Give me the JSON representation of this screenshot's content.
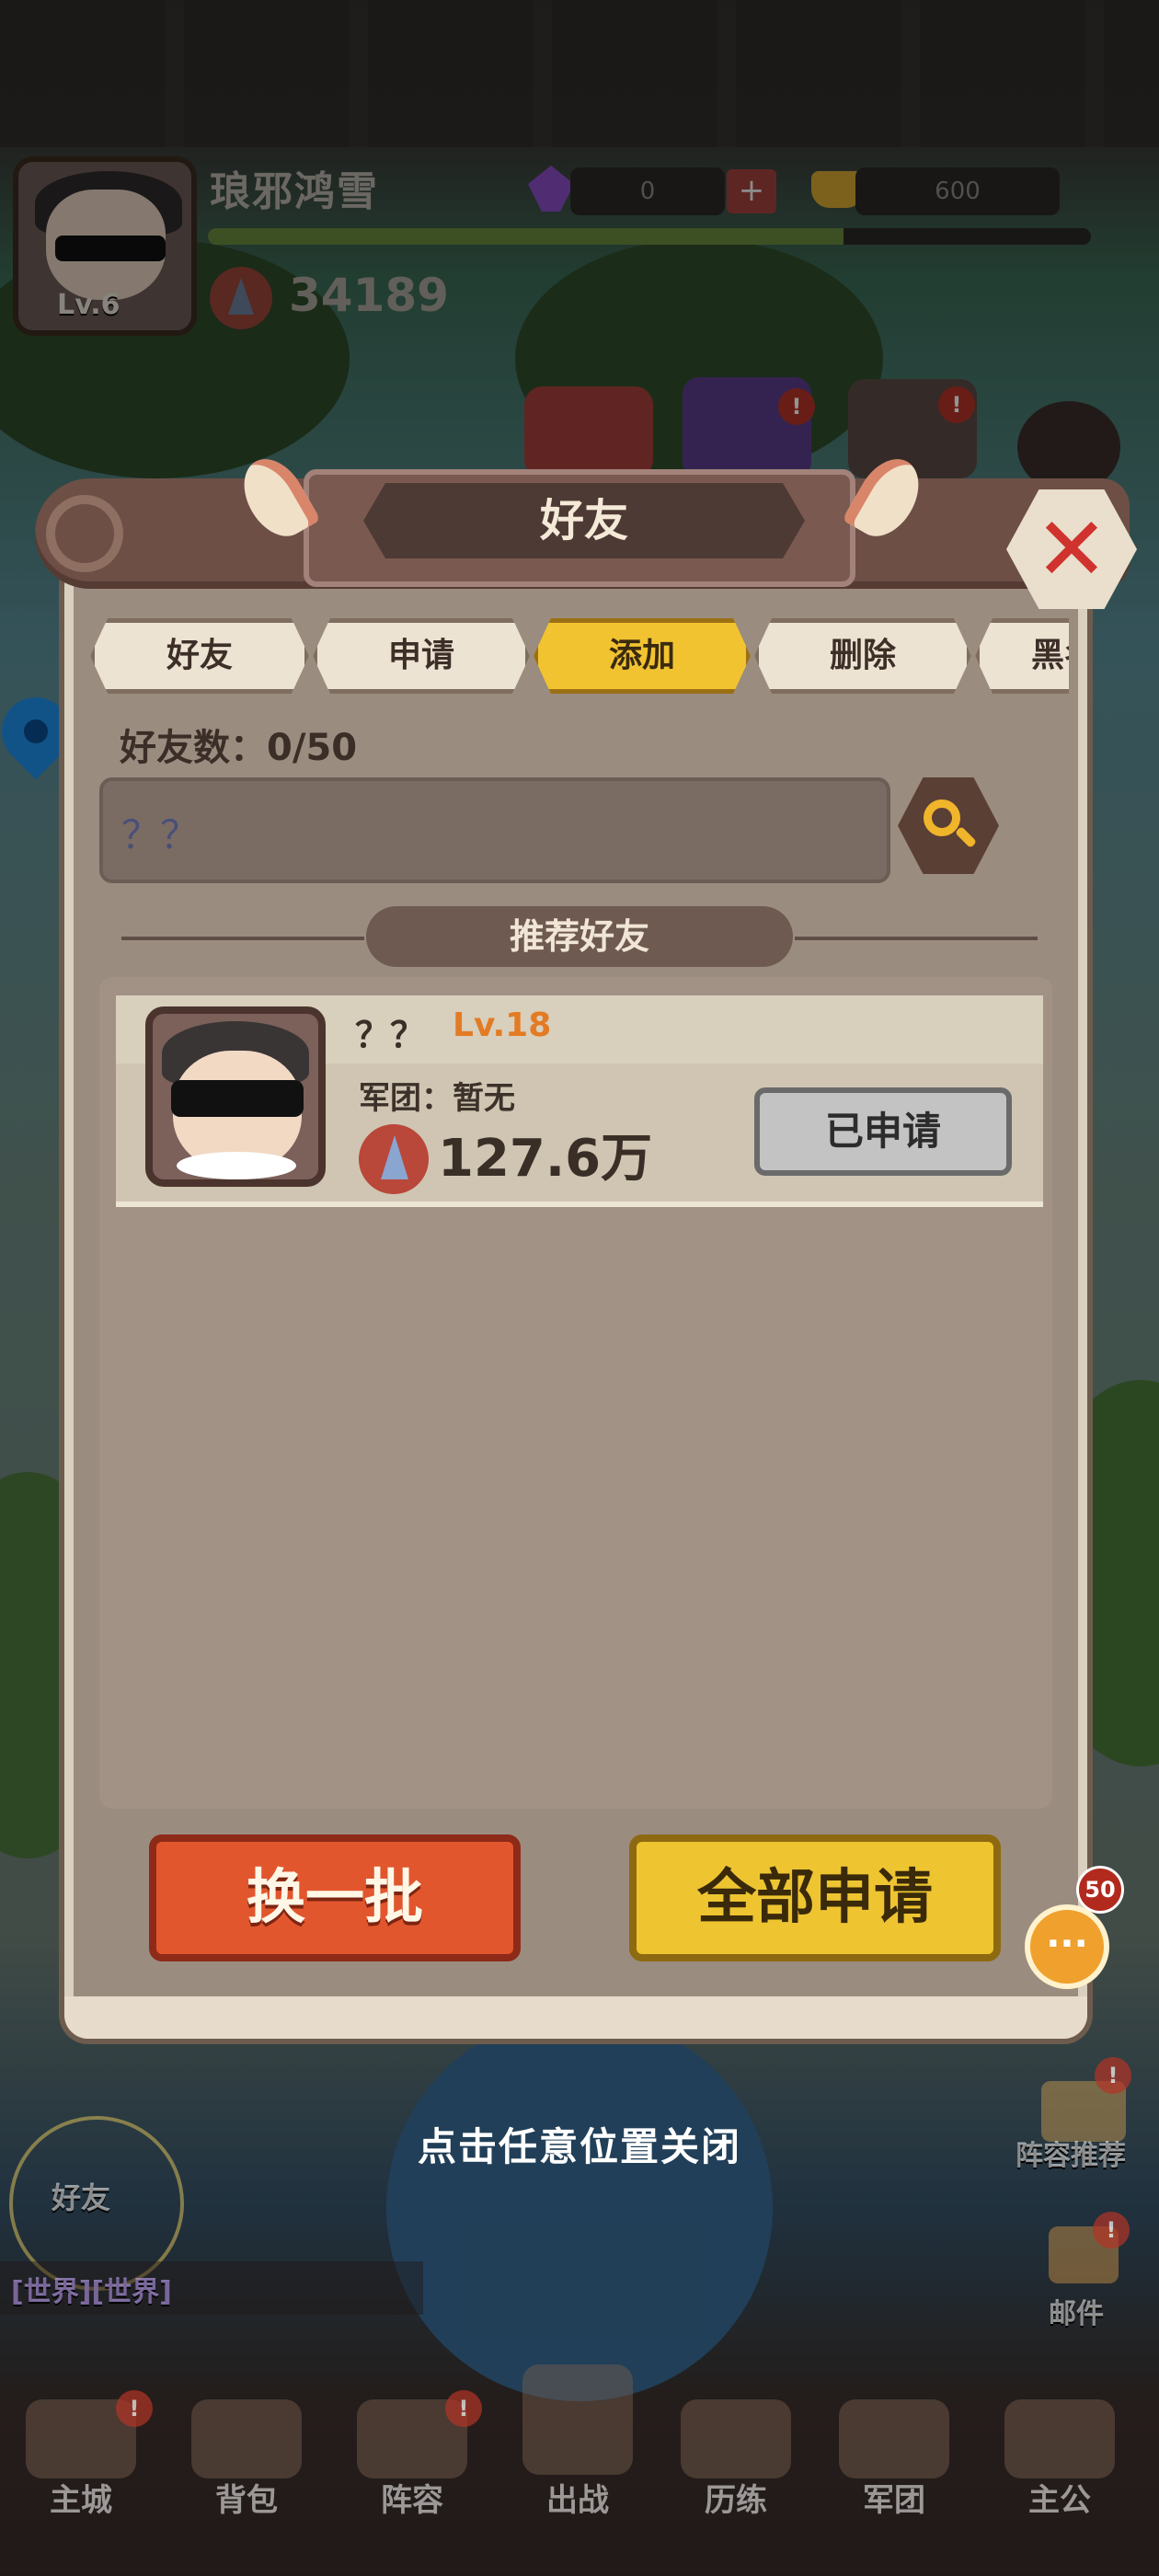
{
  "hud": {
    "player_name": "琅邪鸿雪",
    "level": "Lv.6",
    "gem_count": "0",
    "gold_count": "600",
    "power": "34189",
    "exp_progress": 0.72,
    "plus_symbol": "+"
  },
  "modal": {
    "title": "好友",
    "close_symbol": "✕",
    "tabs": [
      {
        "label": "好友",
        "active": false
      },
      {
        "label": "申请",
        "active": false
      },
      {
        "label": "添加",
        "active": true
      },
      {
        "label": "删除",
        "active": false
      },
      {
        "label": "黑名单",
        "active": false
      }
    ],
    "friend_count": "好友数：0/50",
    "search": {
      "value": "？？",
      "placeholder": "？？"
    },
    "section_title": "推荐好友",
    "recommended": [
      {
        "name": "？？",
        "level": "Lv.18",
        "guild": "军团：暂无",
        "power": "127.6万",
        "button_label": "已申请"
      }
    ],
    "refresh_button": "换一批",
    "apply_all_button": "全部申请"
  },
  "chat": {
    "badge": "50",
    "icon": "chat-bubble-icon",
    "dots": "···"
  },
  "close_hint": "点击任意位置关闭",
  "side": {
    "friends_label": "好友",
    "world_chat": "[世界][世界]",
    "lineup_label": "阵容推荐",
    "mail_label": "邮件"
  },
  "badges": {
    "top_icon_1": "!",
    "top_icon_2": "!",
    "lineup": "!",
    "mail": "!",
    "nav_main": "!",
    "nav_arena": "!"
  },
  "bottom_nav": [
    "主城",
    "背包",
    "阵容",
    "出战",
    "历练",
    "军团",
    "主公"
  ],
  "colors": {
    "accent_gold": "#f2c331",
    "accent_red": "#e2562e",
    "level_orange": "#e37b24"
  }
}
